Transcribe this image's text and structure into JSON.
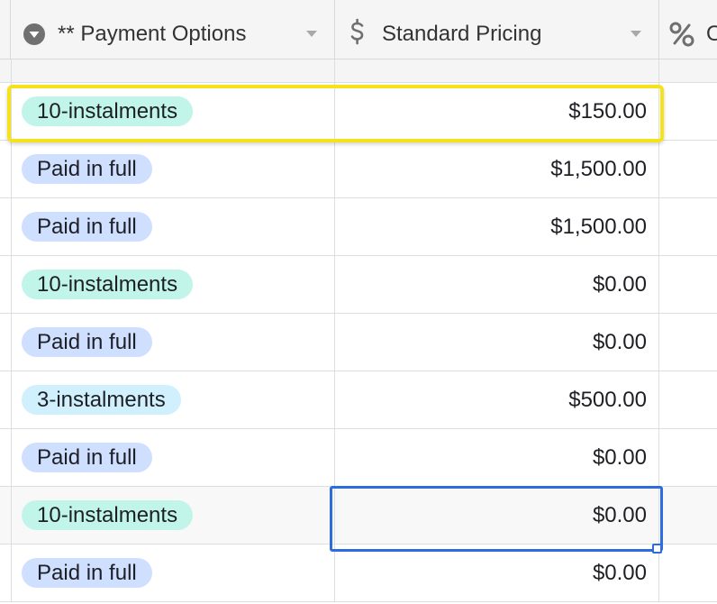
{
  "header": {
    "columns": [
      {
        "label": "** Payment Options",
        "icon": "single-select-field-icon"
      },
      {
        "label": "Standard Pricing",
        "icon": "currency-field-icon"
      },
      {
        "label": "O",
        "icon": "percent-field-icon"
      }
    ]
  },
  "rows": [
    {
      "option": "10-instalments",
      "price": "$150.00"
    },
    {
      "option": "Paid in full",
      "price": "$1,500.00"
    },
    {
      "option": "Paid in full",
      "price": "$1,500.00"
    },
    {
      "option": "10-instalments",
      "price": "$0.00"
    },
    {
      "option": "Paid in full",
      "price": "$0.00"
    },
    {
      "option": "3-instalments",
      "price": "$500.00"
    },
    {
      "option": "Paid in full",
      "price": "$0.00"
    },
    {
      "option": "10-instalments",
      "price": "$0.00"
    },
    {
      "option": "Paid in full",
      "price": "$0.00"
    }
  ],
  "colors": {
    "10-instalments": "#c2f5e9",
    "Paid in full": "#cfdfff",
    "3-instalments": "#d0f0fd",
    "highlight": "#f5e21a",
    "selection": "#2d6cdf"
  }
}
